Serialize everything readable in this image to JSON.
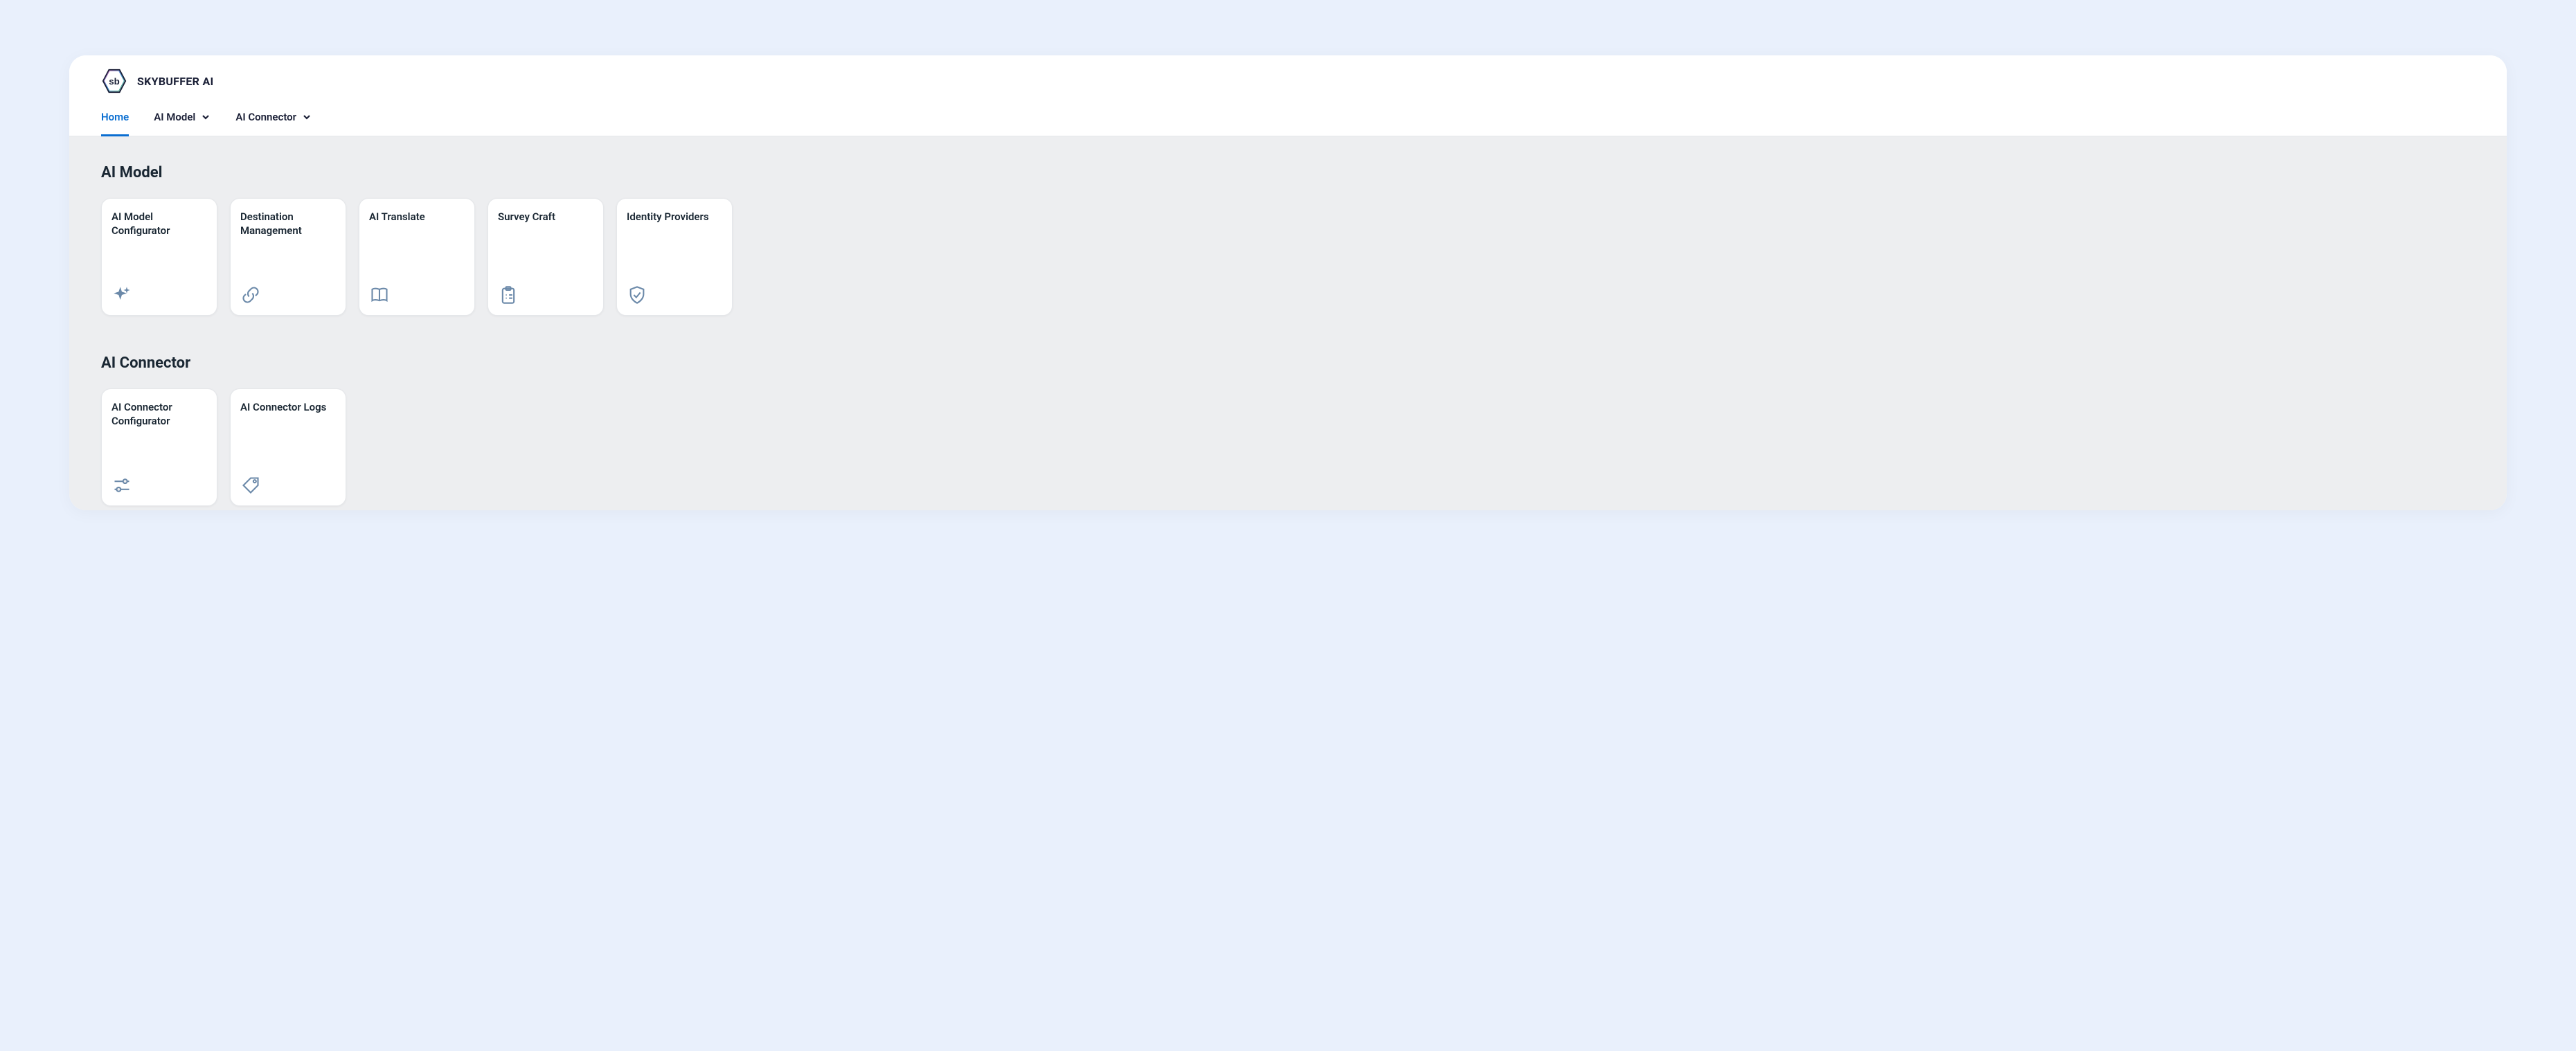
{
  "brand": {
    "name": "SKYBUFFER AI"
  },
  "nav": {
    "items": [
      {
        "label": "Home",
        "active": true,
        "has_dropdown": false
      },
      {
        "label": "AI Model",
        "active": false,
        "has_dropdown": true
      },
      {
        "label": "AI Connector",
        "active": false,
        "has_dropdown": true
      }
    ]
  },
  "sections": [
    {
      "title": "AI Model",
      "tiles": [
        {
          "title": "AI Model Configurator",
          "icon": "sparkle-icon"
        },
        {
          "title": "Destination Management",
          "icon": "link-icon"
        },
        {
          "title": "AI Translate",
          "icon": "book-icon"
        },
        {
          "title": "Survey Craft",
          "icon": "clipboard-icon"
        },
        {
          "title": "Identity Providers",
          "icon": "shield-check-icon"
        }
      ]
    },
    {
      "title": "AI Connector",
      "tiles": [
        {
          "title": "AI Connector Configurator",
          "icon": "sliders-icon"
        },
        {
          "title": "AI Connector Logs",
          "icon": "tag-icon"
        }
      ]
    }
  ]
}
